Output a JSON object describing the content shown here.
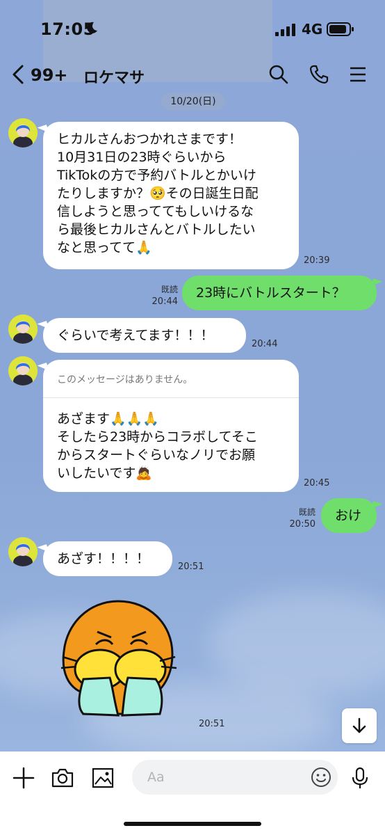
{
  "status_bar": {
    "time": "17:05",
    "network": "4G"
  },
  "header": {
    "unread_count": "99+",
    "title": "ロケマサ"
  },
  "date_label": "10/20(日)",
  "messages": [
    {
      "text": "ヒカルさんおつかれさまです！\n10月31日の23時ぐらいから\nTikTokの方で予約バトルとかいけ\nたりしますか？🥺その日誕生日配\n信しようと思っててもしいけるな\nら最後ヒカルさんとバトルしたい\nなと思ってて🙏",
      "time": "20:39"
    },
    {
      "text": "23時にバトルスタート？",
      "time": "20:44",
      "read": "既読"
    },
    {
      "text": "ぐらいで考えてます！！！",
      "time": "20:44"
    },
    {
      "quoted": "このメッセージはありません。",
      "text": "あざます🙏🙏🙏\nそしたら23時からコラボしてそこ\nからスタートぐらいなノリでお願\nいしたいです🙇",
      "time": "20:45"
    },
    {
      "text": "おけ",
      "time": "20:50",
      "read": "既読"
    },
    {
      "text": "あざす！！！！",
      "time": "20:51"
    },
    {
      "time": "20:51"
    }
  ],
  "composer": {
    "placeholder": "Aa"
  },
  "icons": {
    "back": "chevron-left-icon",
    "search": "search-icon",
    "call": "phone-icon",
    "menu": "menu-icon",
    "plus": "plus-icon",
    "camera": "camera-icon",
    "image": "image-icon",
    "emoji": "smile-icon",
    "mic": "microphone-icon",
    "scroll": "arrow-down-icon"
  },
  "colors": {
    "chat_bg": "#8aa6d6",
    "outgoing": "#6fde6b",
    "incoming": "#ffffff",
    "avatar_bg": "#dde43a"
  }
}
